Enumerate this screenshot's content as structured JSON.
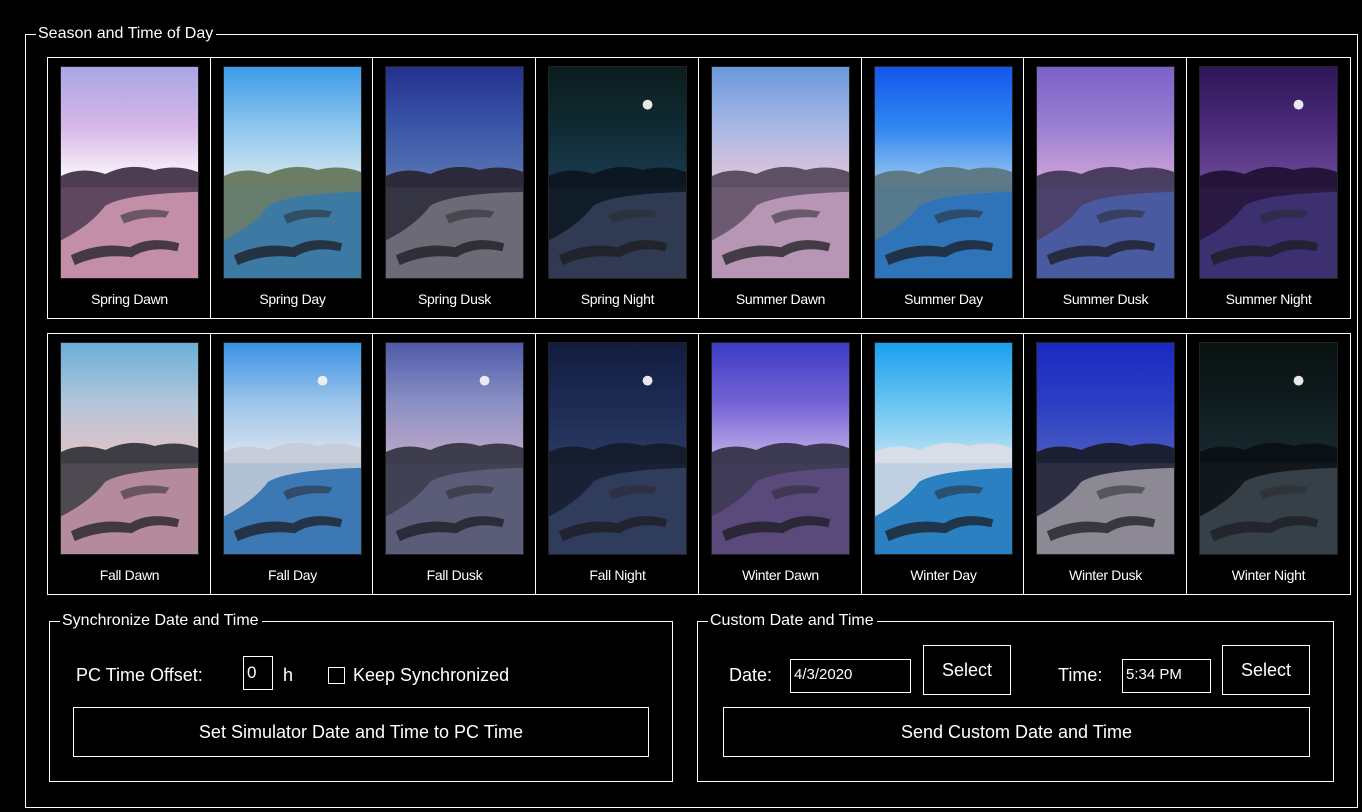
{
  "season_group": {
    "title": "Season and Time of Day",
    "presets": [
      {
        "label": "Spring Dawn",
        "sky": [
          "#a9a6e6",
          "#d7b6e6",
          "#ffffff"
        ],
        "terrain": "#4e3c52",
        "water": "#c28fa6",
        "moon": false
      },
      {
        "label": "Spring Day",
        "sky": [
          "#3d9ce8",
          "#8cc6ee",
          "#d7e7ec"
        ],
        "terrain": "#6c7d66",
        "water": "#3d7aa3",
        "moon": false
      },
      {
        "label": "Spring Dusk",
        "sky": [
          "#24308e",
          "#3a56a8",
          "#5b77b4"
        ],
        "terrain": "#2c2a3a",
        "water": "#6d6a78",
        "moon": false
      },
      {
        "label": "Spring Night",
        "sky": [
          "#0b1d1d",
          "#0f2a33",
          "#1a3b52"
        ],
        "terrain": "#0c1722",
        "water": "#303a52",
        "moon": true
      },
      {
        "label": "Summer Dawn",
        "sky": [
          "#6a98dc",
          "#a8b8e4",
          "#e5c6d6"
        ],
        "terrain": "#5e5064",
        "water": "#b696b4",
        "moon": false
      },
      {
        "label": "Summer Day",
        "sky": [
          "#1556ee",
          "#2f86f0",
          "#9cc8ee"
        ],
        "terrain": "#5e7a86",
        "water": "#2f74b8",
        "moon": false
      },
      {
        "label": "Summer Dusk",
        "sky": [
          "#7b62c8",
          "#9a7ed2",
          "#d4a6d8"
        ],
        "terrain": "#4a3e60",
        "water": "#4a5aa0",
        "moon": false
      },
      {
        "label": "Summer Night",
        "sky": [
          "#2e1656",
          "#4a2a7a",
          "#6c4a98"
        ],
        "terrain": "#24143a",
        "water": "#3c3070",
        "moon": true
      },
      {
        "label": "Fall Dawn",
        "sky": [
          "#6aaed8",
          "#b2c6da",
          "#e6c2c6"
        ],
        "terrain": "#3c3e44",
        "water": "#b48a9c",
        "moon": false
      },
      {
        "label": "Fall Day",
        "sky": [
          "#3a92e4",
          "#9cc4ea",
          "#dde6ef"
        ],
        "terrain": "#c6ccd8",
        "water": "#3c78b4",
        "moon": true
      },
      {
        "label": "Fall Dusk",
        "sky": [
          "#4e5aa8",
          "#8a90c4",
          "#c0a8c8"
        ],
        "terrain": "#3c3c4c",
        "water": "#5a5c78",
        "moon": true
      },
      {
        "label": "Fall Night",
        "sky": [
          "#121c3e",
          "#1c2a52",
          "#2a3a64"
        ],
        "terrain": "#141c2e",
        "water": "#303c5c",
        "moon": true
      },
      {
        "label": "Winter Dawn",
        "sky": [
          "#3a3cc4",
          "#7462d4",
          "#c2b2ea"
        ],
        "terrain": "#3c3a52",
        "water": "#5a4a7c",
        "moon": false
      },
      {
        "label": "Winter Day",
        "sky": [
          "#1aa0ee",
          "#66c4f2",
          "#bfe2f4"
        ],
        "terrain": "#d8dee8",
        "water": "#2a80c0",
        "moon": false
      },
      {
        "label": "Winter Dusk",
        "sky": [
          "#1a2ac0",
          "#2a3ec4",
          "#4a5cc0"
        ],
        "terrain": "#1c1e34",
        "water": "#8c8894",
        "moon": false
      },
      {
        "label": "Winter Night",
        "sky": [
          "#0a1212",
          "#0e1c1e",
          "#182a30"
        ],
        "terrain": "#0a1014",
        "water": "#364048",
        "moon": true
      }
    ]
  },
  "sync_group": {
    "title": "Synchronize Date and Time",
    "offset_label": "PC Time Offset:",
    "offset_value": "0",
    "offset_unit": "h",
    "keep_sync_label": "Keep Synchronized",
    "keep_sync_checked": false,
    "set_button": "Set Simulator Date and Time to PC Time"
  },
  "custom_group": {
    "title": "Custom Date and Time",
    "date_label": "Date:",
    "date_value": "4/3/2020",
    "date_select": "Select",
    "time_label": "Time:",
    "time_value": "5:34 PM",
    "time_select": "Select",
    "send_button": "Send Custom Date and Time"
  }
}
